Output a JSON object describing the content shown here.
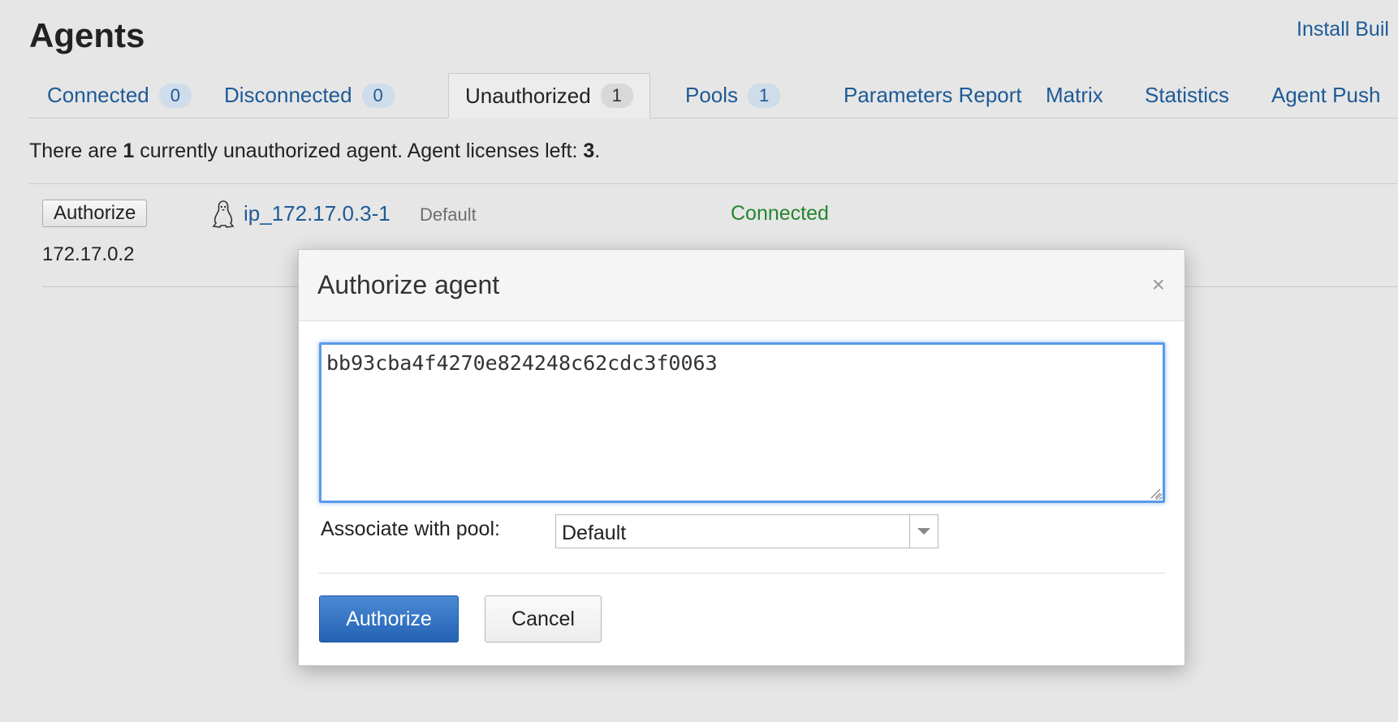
{
  "page": {
    "title": "Agents",
    "install_link": "Install Buil"
  },
  "tabs": [
    {
      "label": "Connected",
      "count": "0"
    },
    {
      "label": "Disconnected",
      "count": "0"
    },
    {
      "label": "Unauthorized",
      "count": "1"
    },
    {
      "label": "Pools",
      "count": "1"
    },
    {
      "label": "Parameters Report"
    },
    {
      "label": "Matrix"
    },
    {
      "label": "Statistics"
    },
    {
      "label": "Agent Push"
    }
  ],
  "active_tab": "Unauthorized",
  "summary": {
    "prefix": "There are ",
    "count": "1",
    "middle": " currently unauthorized agent. Agent licenses left: ",
    "licenses_left": "3",
    "suffix": "."
  },
  "agent": {
    "authorize_label": "Authorize",
    "ip": "172.17.0.2",
    "os_icon": "linux-tux-icon",
    "name": "ip_172.17.0.3-1",
    "pool": "Default",
    "status": "Connected",
    "status_color": "#23862f"
  },
  "dialog": {
    "title": "Authorize agent",
    "close_symbol": "×",
    "comment_value": "bb93cba4f4270e824248c62cdc3f0063",
    "pool_label": "Associate with pool:",
    "pool_selected": "Default",
    "authorize_label": "Authorize",
    "cancel_label": "Cancel"
  },
  "colors": {
    "link": "#1e5a96",
    "primary_button": "#2e6fc4",
    "focus_ring": "#5b9ae8"
  }
}
